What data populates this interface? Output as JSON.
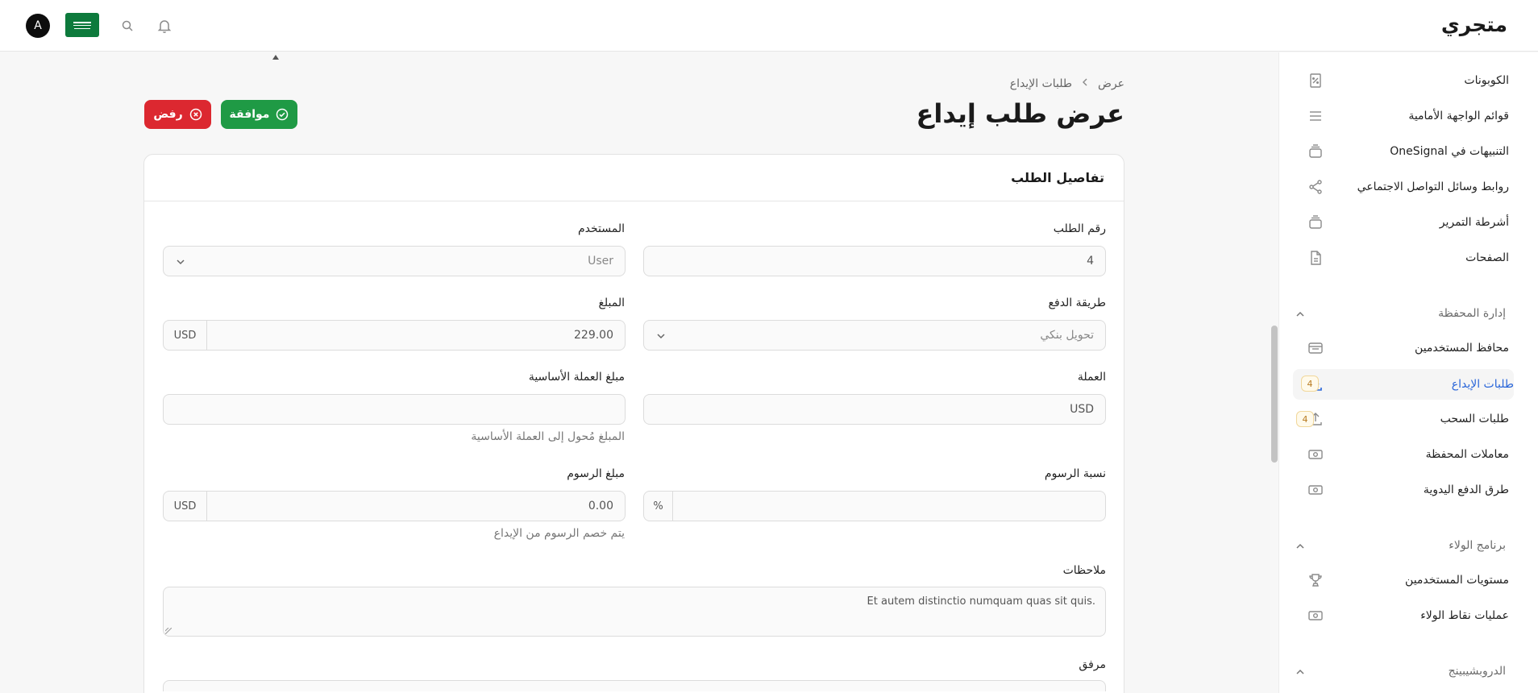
{
  "topbar": {
    "brand": "متجري",
    "avatar_initial": "A",
    "icons": [
      "bell-icon",
      "search-icon",
      "saudi-flag"
    ]
  },
  "sidebar": {
    "items_top": [
      {
        "label": "الكوبونات",
        "icon": "coupon-icon"
      },
      {
        "label": "قوائم الواجهة الأمامية",
        "icon": "menu-lines-icon"
      },
      {
        "label": "التنبيهات في OneSignal",
        "icon": "stack-icon"
      },
      {
        "label": "روابط وسائل التواصل الاجتماعي",
        "icon": "share-icon"
      },
      {
        "label": "أشرطة التمرير",
        "icon": "stack-icon"
      },
      {
        "label": "الصفحات",
        "icon": "document-icon"
      }
    ],
    "group_wallet": {
      "label": "إدارة المحفظة",
      "items": [
        {
          "label": "محافظ المستخدمين",
          "icon": "wallet-icon"
        },
        {
          "label": "طلبات الإيداع",
          "icon": "download-icon",
          "badge": "4",
          "active": true
        },
        {
          "label": "طلبات السحب",
          "icon": "upload-icon",
          "badge": "4"
        },
        {
          "label": "معاملات المحفظة",
          "icon": "banknote-icon"
        },
        {
          "label": "طرق الدفع اليدوية",
          "icon": "banknote-icon"
        }
      ]
    },
    "group_loyalty": {
      "label": "برنامج الولاء",
      "items": [
        {
          "label": "مستويات المستخدمين",
          "icon": "trophy-icon"
        },
        {
          "label": "عمليات نقاط الولاء",
          "icon": "banknote-icon"
        }
      ]
    },
    "group_drop": {
      "label": "الدروبشيبينج"
    }
  },
  "breadcrumb": {
    "parent": "طلبات الإيداع",
    "current": "عرض"
  },
  "page": {
    "title": "عرض طلب إيداع",
    "approve_label": "موافقة",
    "reject_label": "رفض"
  },
  "card": {
    "title": "تفاصيل الطلب"
  },
  "form": {
    "order_number": {
      "label": "رقم الطلب",
      "value": "4"
    },
    "user": {
      "label": "المستخدم",
      "placeholder": "User"
    },
    "payment_method": {
      "label": "طريقة الدفع",
      "value": "تحويل بنكي"
    },
    "amount": {
      "label": "المبلغ",
      "value": "229.00",
      "currency": "USD"
    },
    "currency": {
      "label": "العملة",
      "value": "USD"
    },
    "base_amount": {
      "label": "مبلغ العملة الأساسية",
      "value": "",
      "helper": "المبلغ مُحول إلى العملة الأساسية"
    },
    "fee_rate": {
      "label": "نسبة الرسوم",
      "value": "",
      "unit": "%"
    },
    "fee_amount": {
      "label": "مبلغ الرسوم",
      "value": "0.00",
      "currency": "USD",
      "helper": "يتم خصم الرسوم من الإيداع"
    },
    "notes": {
      "label": "ملاحظات",
      "value": "Et autem distinctio numquam quas sit quis."
    },
    "attachment": {
      "label": "مرفق"
    }
  }
}
